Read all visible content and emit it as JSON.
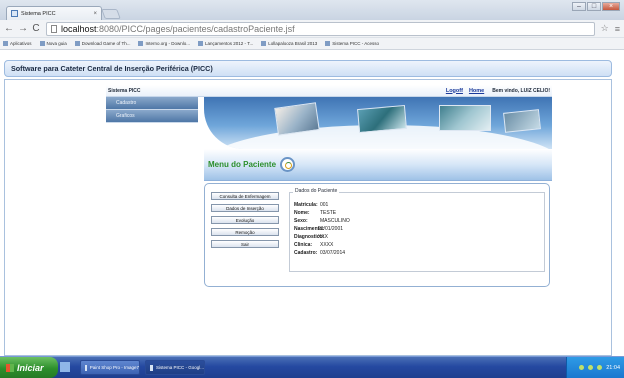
{
  "browser": {
    "tab_title": "Sistema PICC",
    "url_host": "localhost",
    "url_path": ":8080/PICC/pages/pacientes/cadastroPaciente.jsf",
    "bookmarks": [
      "Aplicativos",
      "Nova guia",
      "Download Game of Th...",
      "Interno.org - Downlo...",
      "Lançamentos 2012 - T...",
      "Lollapalooza Brasil 2013",
      "Sistema PICC - Acesso"
    ]
  },
  "app": {
    "title": "Software para Cateter Central de Inserção Periférica (PICC)",
    "system_name": "Sistema PICC",
    "logoff": "Logoff",
    "home": "Home",
    "welcome": "Bem vindo, LUIZ CELIO!"
  },
  "sidebar": {
    "items": [
      "Cadastro",
      "Graficos"
    ]
  },
  "menu": {
    "title": "Menu do Paciente"
  },
  "actions": [
    "Consulta de Enfermagem",
    "Dados de Inserção",
    "Evolução",
    "Remoção",
    "Sair"
  ],
  "patient": {
    "legend": "Dados do Paciente",
    "fields": [
      {
        "label": "Matricula:",
        "value": "001"
      },
      {
        "label": "Nome:",
        "value": "TESTE"
      },
      {
        "label": "Sexo:",
        "value": "MASCULINO"
      },
      {
        "label": "Nascimento:",
        "value": "01/01/2001"
      },
      {
        "label": "Diagnostico:",
        "value": "XXX"
      },
      {
        "label": "Clinica:",
        "value": "XXXX"
      },
      {
        "label": "Cadastro:",
        "value": "03/07/2014"
      }
    ]
  },
  "taskbar": {
    "start": "Iniciar",
    "tasks": [
      "Paint Shop Pro - Image7",
      "Sistema PICC - Googl..."
    ],
    "clock": "21:04"
  }
}
